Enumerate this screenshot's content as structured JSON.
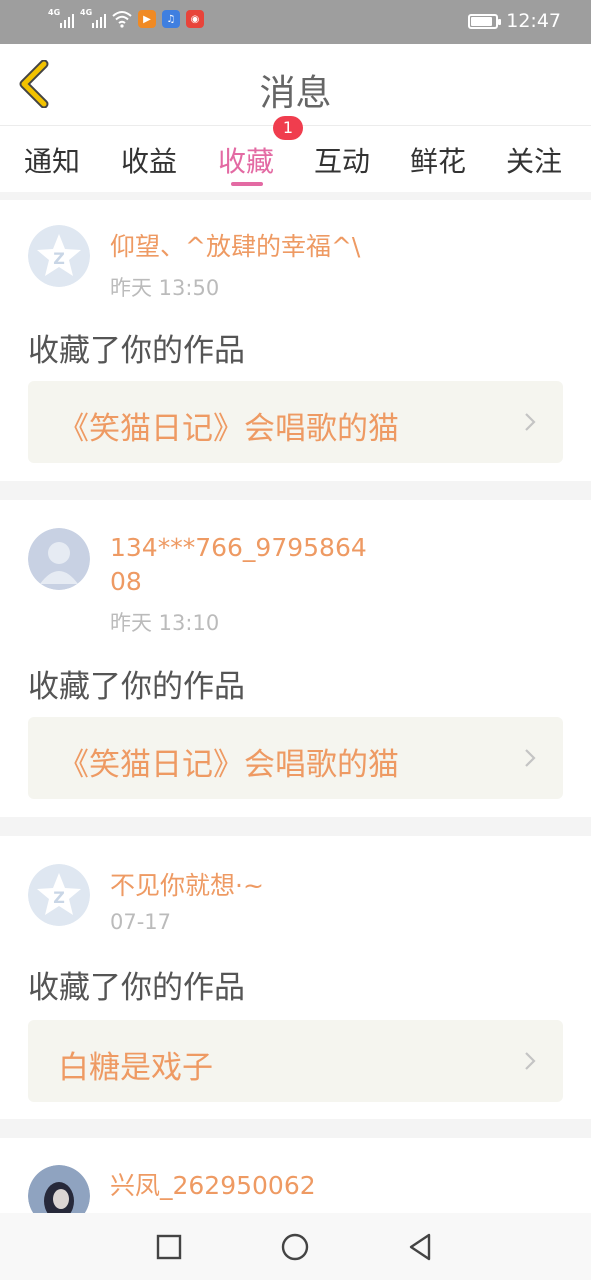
{
  "status": {
    "net1": "4G",
    "net2": "4G",
    "time": "12:47",
    "battery_level": 0.85
  },
  "header": {
    "back_icon": "chevron-left-icon",
    "title": "消息"
  },
  "tabs": [
    {
      "label": "通知"
    },
    {
      "label": "收益"
    },
    {
      "label": "收藏",
      "active": true,
      "badge": "1"
    },
    {
      "label": "互动"
    },
    {
      "label": "鲜花"
    },
    {
      "label": "关注"
    }
  ],
  "messages": [
    {
      "user": "仰望、^放肆的幸福^\\",
      "time": "昨天 13:50",
      "action": "收藏了你的作品",
      "work": "《笑猫日记》会唱歌的猫",
      "avatar": "qzone-star-icon"
    },
    {
      "user_line1": "134***766_9795864",
      "user_line2": "08",
      "time": "昨天 13:10",
      "action": "收藏了你的作品",
      "work": "《笑猫日记》会唱歌的猫",
      "avatar": "default-person-icon"
    },
    {
      "user": "不见你就想·~",
      "time": "07-17",
      "action": "收藏了你的作品",
      "work": "白糖是戏子",
      "avatar": "qzone-star-icon"
    },
    {
      "user": "兴凤_262950062",
      "avatar": "photo-avatar"
    }
  ],
  "colors": {
    "accent_pink": "#e36aa3",
    "username_orange": "#ee9a63",
    "badge_red": "#f03d4e",
    "back_yellow": "#f2c200"
  }
}
